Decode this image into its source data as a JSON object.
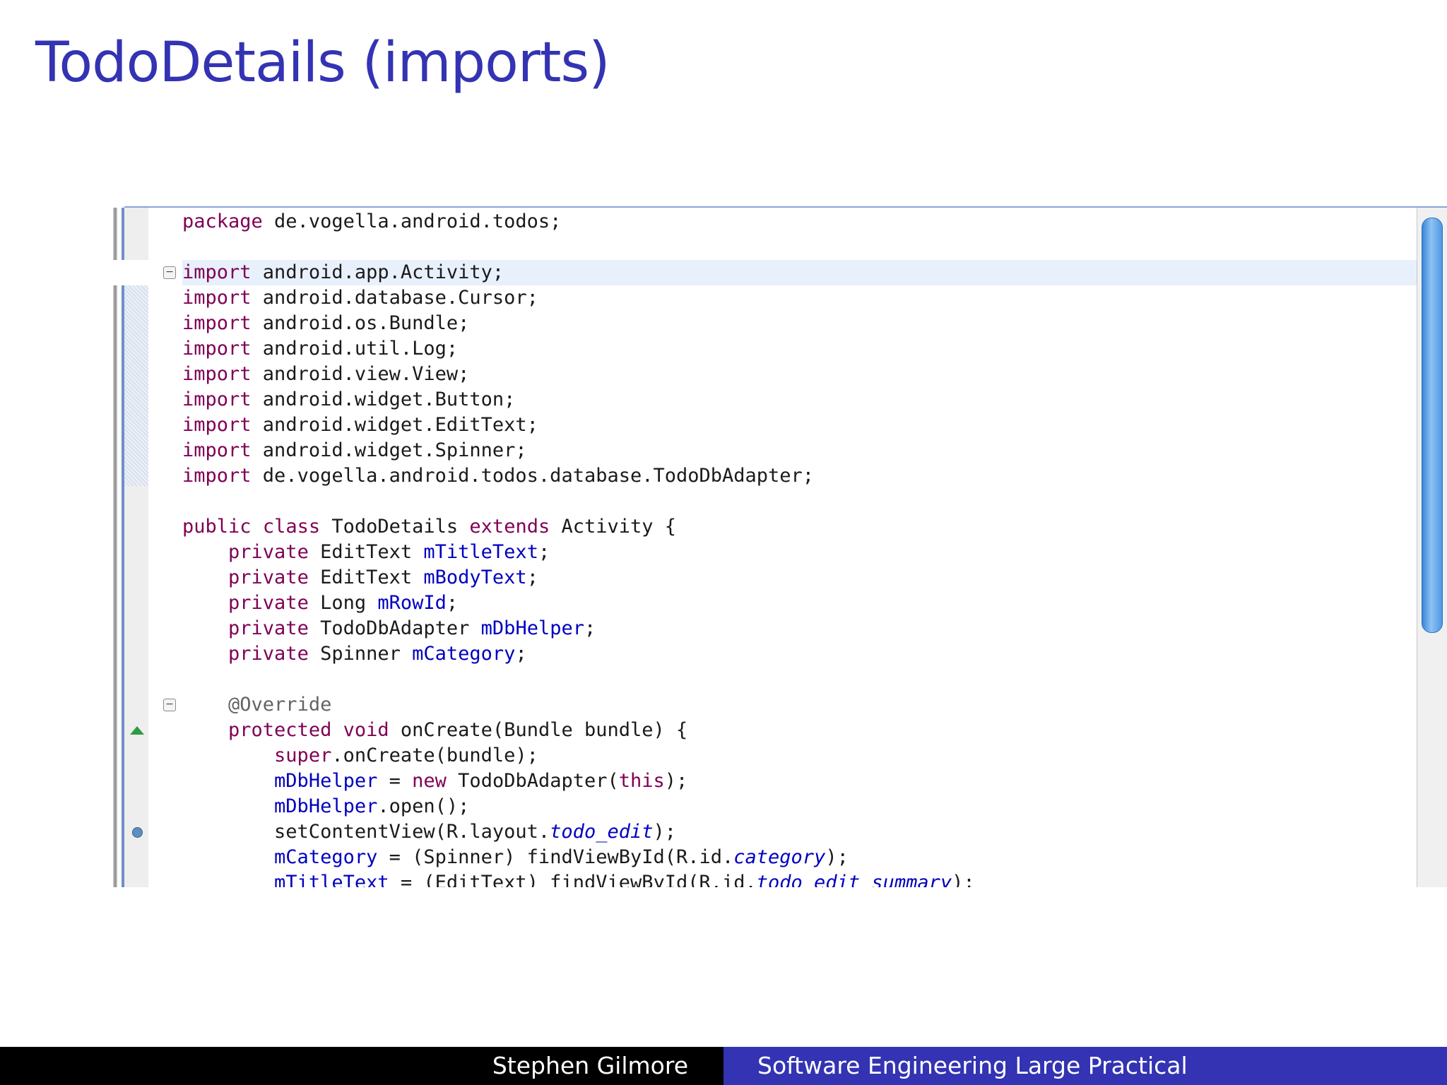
{
  "slide": {
    "title": "TodoDetails (imports)",
    "footer_author": "Stephen Gilmore",
    "footer_course": "Software Engineering Large Practical"
  },
  "colors": {
    "title": "#3333b3",
    "footer_left": "#000000",
    "footer_right": "#3333b3",
    "keyword": "#7f0055",
    "field": "#0000c0",
    "annotation": "#646464"
  },
  "editor": {
    "lines": [
      {
        "tokens": [
          {
            "t": "package",
            "c": "kw"
          },
          {
            "t": " de.vogella.android.todos;",
            "c": "tx"
          }
        ]
      },
      {
        "tokens": []
      },
      {
        "current": true,
        "fold": "minus-icon",
        "tokens": [
          {
            "t": "import",
            "c": "kw"
          },
          {
            "t": " android.app.Activity;",
            "c": "tx"
          }
        ]
      },
      {
        "tokens": [
          {
            "t": "import",
            "c": "kw"
          },
          {
            "t": " android.database.Cursor;",
            "c": "tx"
          }
        ]
      },
      {
        "tokens": [
          {
            "t": "import",
            "c": "kw"
          },
          {
            "t": " android.os.Bundle;",
            "c": "tx"
          }
        ]
      },
      {
        "tokens": [
          {
            "t": "import",
            "c": "kw"
          },
          {
            "t": " android.util.Log;",
            "c": "tx"
          }
        ]
      },
      {
        "tokens": [
          {
            "t": "import",
            "c": "kw"
          },
          {
            "t": " android.view.View;",
            "c": "tx"
          }
        ]
      },
      {
        "tokens": [
          {
            "t": "import",
            "c": "kw"
          },
          {
            "t": " android.widget.Button;",
            "c": "tx"
          }
        ]
      },
      {
        "tokens": [
          {
            "t": "import",
            "c": "kw"
          },
          {
            "t": " android.widget.EditText;",
            "c": "tx"
          }
        ]
      },
      {
        "tokens": [
          {
            "t": "import",
            "c": "kw"
          },
          {
            "t": " android.widget.Spinner;",
            "c": "tx"
          }
        ]
      },
      {
        "tokens": [
          {
            "t": "import",
            "c": "kw"
          },
          {
            "t": " de.vogella.android.todos.database.TodoDbAdapter;",
            "c": "tx"
          }
        ]
      },
      {
        "tokens": []
      },
      {
        "tokens": [
          {
            "t": "public",
            "c": "kw"
          },
          {
            "t": " ",
            "c": "tx"
          },
          {
            "t": "class",
            "c": "kw"
          },
          {
            "t": " TodoDetails ",
            "c": "tx"
          },
          {
            "t": "extends",
            "c": "kw"
          },
          {
            "t": " Activity {",
            "c": "tx"
          }
        ]
      },
      {
        "tokens": [
          {
            "t": "    ",
            "c": "tx"
          },
          {
            "t": "private",
            "c": "kw"
          },
          {
            "t": " EditText ",
            "c": "tx"
          },
          {
            "t": "mTitleText",
            "c": "fld"
          },
          {
            "t": ";",
            "c": "tx"
          }
        ]
      },
      {
        "tokens": [
          {
            "t": "    ",
            "c": "tx"
          },
          {
            "t": "private",
            "c": "kw"
          },
          {
            "t": " EditText ",
            "c": "tx"
          },
          {
            "t": "mBodyText",
            "c": "fld"
          },
          {
            "t": ";",
            "c": "tx"
          }
        ]
      },
      {
        "tokens": [
          {
            "t": "    ",
            "c": "tx"
          },
          {
            "t": "private",
            "c": "kw"
          },
          {
            "t": " Long ",
            "c": "tx"
          },
          {
            "t": "mRowId",
            "c": "fld"
          },
          {
            "t": ";",
            "c": "tx"
          }
        ]
      },
      {
        "tokens": [
          {
            "t": "    ",
            "c": "tx"
          },
          {
            "t": "private",
            "c": "kw"
          },
          {
            "t": " TodoDbAdapter ",
            "c": "tx"
          },
          {
            "t": "mDbHelper",
            "c": "fld"
          },
          {
            "t": ";",
            "c": "tx"
          }
        ]
      },
      {
        "tokens": [
          {
            "t": "    ",
            "c": "tx"
          },
          {
            "t": "private",
            "c": "kw"
          },
          {
            "t": " Spinner ",
            "c": "tx"
          },
          {
            "t": "mCategory",
            "c": "fld"
          },
          {
            "t": ";",
            "c": "tx"
          }
        ]
      },
      {
        "tokens": []
      },
      {
        "fold": "minus-icon",
        "tokens": [
          {
            "t": "    ",
            "c": "tx"
          },
          {
            "t": "@Override",
            "c": "ann"
          }
        ]
      },
      {
        "marker": "override-triangle-icon",
        "tokens": [
          {
            "t": "    ",
            "c": "tx"
          },
          {
            "t": "protected",
            "c": "kw"
          },
          {
            "t": " ",
            "c": "tx"
          },
          {
            "t": "void",
            "c": "kw"
          },
          {
            "t": " onCreate(Bundle bundle) {",
            "c": "tx"
          }
        ]
      },
      {
        "tokens": [
          {
            "t": "        ",
            "c": "tx"
          },
          {
            "t": "super",
            "c": "kw"
          },
          {
            "t": ".onCreate(bundle);",
            "c": "tx"
          }
        ]
      },
      {
        "tokens": [
          {
            "t": "        ",
            "c": "tx"
          },
          {
            "t": "mDbHelper",
            "c": "fld"
          },
          {
            "t": " = ",
            "c": "tx"
          },
          {
            "t": "new",
            "c": "kw"
          },
          {
            "t": " TodoDbAdapter(",
            "c": "tx"
          },
          {
            "t": "this",
            "c": "kw"
          },
          {
            "t": ");",
            "c": "tx"
          }
        ]
      },
      {
        "tokens": [
          {
            "t": "        ",
            "c": "tx"
          },
          {
            "t": "mDbHelper",
            "c": "fld"
          },
          {
            "t": ".open();",
            "c": "tx"
          }
        ]
      },
      {
        "marker": "bookmark-dot-icon",
        "tokens": [
          {
            "t": "        setContentView(R.layout.",
            "c": "tx"
          },
          {
            "t": "todo_edit",
            "c": "it"
          },
          {
            "t": ");",
            "c": "tx"
          }
        ]
      },
      {
        "tokens": [
          {
            "t": "        ",
            "c": "tx"
          },
          {
            "t": "mCategory",
            "c": "fld"
          },
          {
            "t": " = (Spinner) findViewById(R.id.",
            "c": "tx"
          },
          {
            "t": "category",
            "c": "it"
          },
          {
            "t": ");",
            "c": "tx"
          }
        ]
      },
      {
        "tokens": [
          {
            "t": "        ",
            "c": "tx"
          },
          {
            "t": "mTitleText",
            "c": "fld"
          },
          {
            "t": " = (EditText) findViewById(R.id.",
            "c": "tx"
          },
          {
            "t": "todo_edit_summary",
            "c": "it"
          },
          {
            "t": ");",
            "c": "tx"
          }
        ]
      }
    ]
  }
}
